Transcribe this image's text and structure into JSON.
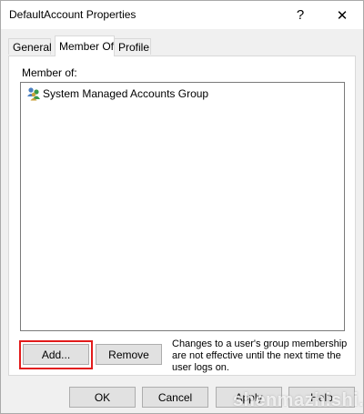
{
  "window": {
    "title": "DefaultAccount Properties",
    "help_glyph": "?",
    "close_glyph": "✕"
  },
  "tabs": [
    {
      "label": "General",
      "active": false
    },
    {
      "label": "Member Of",
      "active": true
    },
    {
      "label": "Profile",
      "active": false
    }
  ],
  "member_of": {
    "label": "Member of:",
    "items": [
      {
        "name": "System Managed Accounts Group",
        "icon": "group-icon"
      }
    ]
  },
  "actions": {
    "add_label": "Add...",
    "remove_label": "Remove",
    "note": "Changes to a user's group membership are not effective until the next time the user logs on."
  },
  "footer": {
    "ok_label": "OK",
    "cancel_label": "Cancel",
    "apply_label": "Apply",
    "help_label": "Help"
  },
  "watermark": "shenmazhishi.com",
  "colors": {
    "highlight": "#e21b1b",
    "button_face": "#e1e1e1",
    "button_border": "#adadad",
    "window_bg": "#f0f0f0"
  }
}
